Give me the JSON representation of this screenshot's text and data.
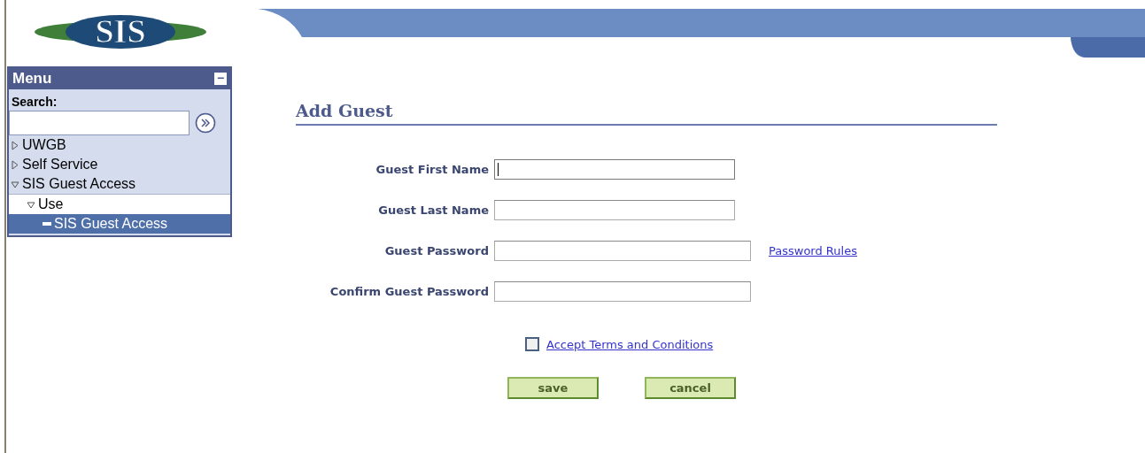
{
  "logo": {
    "text": "SIS"
  },
  "menu": {
    "title": "Menu",
    "collapse_icon": "−",
    "search": {
      "label": "Search:"
    },
    "items": [
      {
        "label": "UWGB",
        "kind": "folder",
        "expanded": false,
        "selected": false
      },
      {
        "label": "Self Service",
        "kind": "folder",
        "expanded": false,
        "selected": false
      },
      {
        "label": "SIS Guest Access",
        "kind": "folder",
        "expanded": true,
        "selected": false,
        "children": [
          {
            "label": "Use",
            "kind": "folder",
            "expanded": true,
            "selected": false,
            "children": [
              {
                "label": "SIS Guest Access",
                "kind": "leaf",
                "selected": true
              }
            ]
          }
        ]
      }
    ]
  },
  "page": {
    "title": "Add Guest",
    "fields": [
      {
        "label": "Guest First Name",
        "wide": false,
        "focused": true
      },
      {
        "label": "Guest Last Name",
        "wide": false,
        "focused": false
      },
      {
        "label": "Guest Password",
        "wide": true,
        "focused": false,
        "link": "Password Rules"
      },
      {
        "label": "Confirm Guest Password",
        "wide": true,
        "focused": false
      }
    ],
    "terms": {
      "label": "Accept Terms and Conditions",
      "checked": false
    },
    "buttons": [
      "save",
      "cancel"
    ]
  }
}
